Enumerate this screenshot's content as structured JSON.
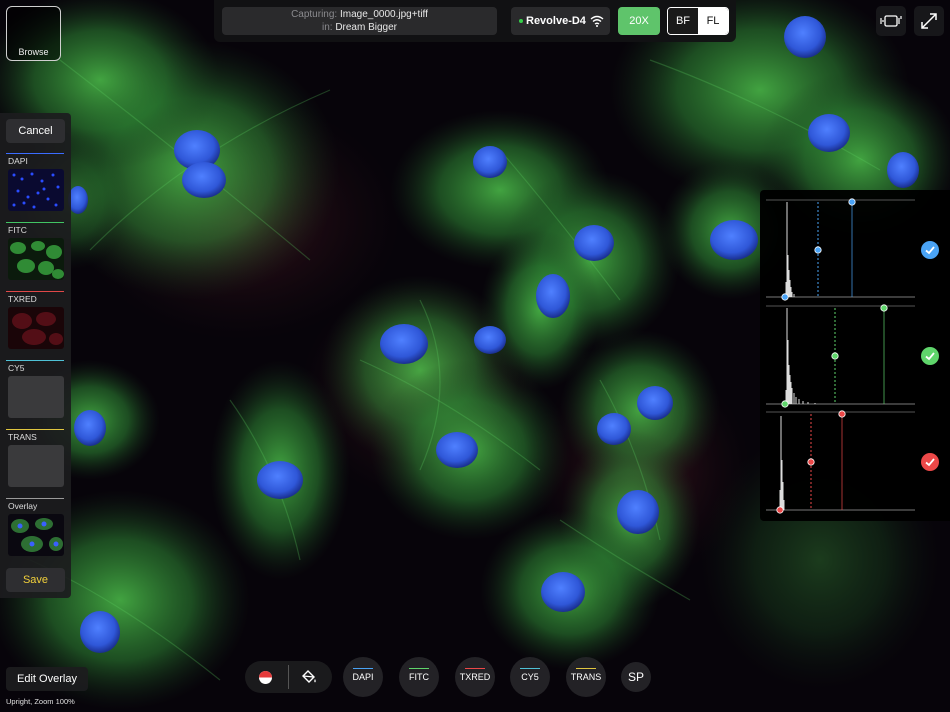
{
  "browse": {
    "label": "Browse"
  },
  "capture": {
    "capturing_label": "Capturing:",
    "file": "Image_0000.jpg+tiff",
    "in_label": "in:",
    "folder": "Dream Bigger"
  },
  "device": {
    "name": "Revolve-D4"
  },
  "objective": {
    "label": "20X"
  },
  "mode": {
    "bf": "BF",
    "fl": "FL",
    "selected": "FL"
  },
  "left_panel": {
    "cancel": "Cancel",
    "save": "Save",
    "channels": [
      {
        "name": "DAPI",
        "color": "#3b6cff"
      },
      {
        "name": "FITC",
        "color": "#41c463"
      },
      {
        "name": "TXRED",
        "color": "#e04848"
      },
      {
        "name": "CY5",
        "color": "#4fc1d6"
      },
      {
        "name": "TRANS",
        "color": "#e0c640"
      },
      {
        "name": "Overlay",
        "color": "#9a9a9a"
      }
    ]
  },
  "histograms": [
    {
      "channel": "DAPI",
      "color": "#4aa3f5",
      "enabled": true
    },
    {
      "channel": "FITC",
      "color": "#5fd56b",
      "enabled": true
    },
    {
      "channel": "TXRED",
      "color": "#ec4848",
      "enabled": true
    }
  ],
  "bottom": {
    "edit_overlay": "Edit Overlay",
    "status": "Upright, Zoom 100%",
    "channel_buttons": [
      {
        "label": "DAPI",
        "color": "#4aa3f5"
      },
      {
        "label": "FITC",
        "color": "#5fd56b"
      },
      {
        "label": "TXRED",
        "color": "#ec4848"
      },
      {
        "label": "CY5",
        "color": "#4fc1d6"
      },
      {
        "label": "TRANS",
        "color": "#e0c640"
      },
      {
        "label": "SP",
        "color": ""
      }
    ]
  },
  "icons": [
    "rotate-device-icon",
    "fullscreen-icon",
    "wifi-icon",
    "record-icon",
    "fill-bucket-icon",
    "checkmark-icon"
  ]
}
